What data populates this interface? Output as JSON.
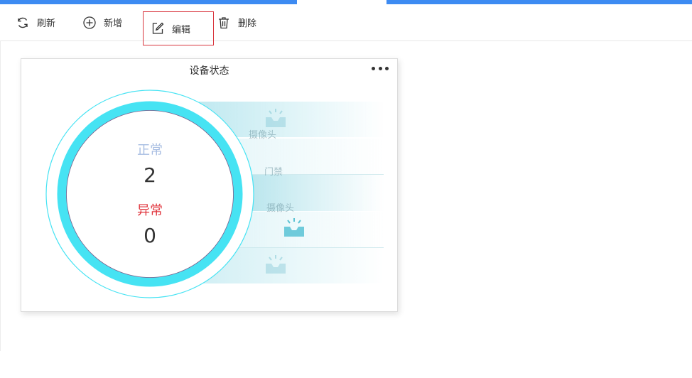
{
  "toolbar": {
    "refresh_label": "刷新",
    "add_label": "新增",
    "edit_label": "编辑",
    "delete_label": "删除"
  },
  "card": {
    "title": "设备状态",
    "normal_label": "正常",
    "normal_value": "2",
    "abnormal_label": "异常",
    "abnormal_value": "0",
    "devices": [
      {
        "label": "摄像头"
      },
      {
        "label": "门禁"
      },
      {
        "label": "摄像头"
      }
    ]
  },
  "colors": {
    "accent_blue": "#3d8bf2",
    "gauge_ring": "#46e3f3",
    "abnormal": "#e0343c",
    "normal": "#a7bde2",
    "selected_border": "#d9363e"
  }
}
